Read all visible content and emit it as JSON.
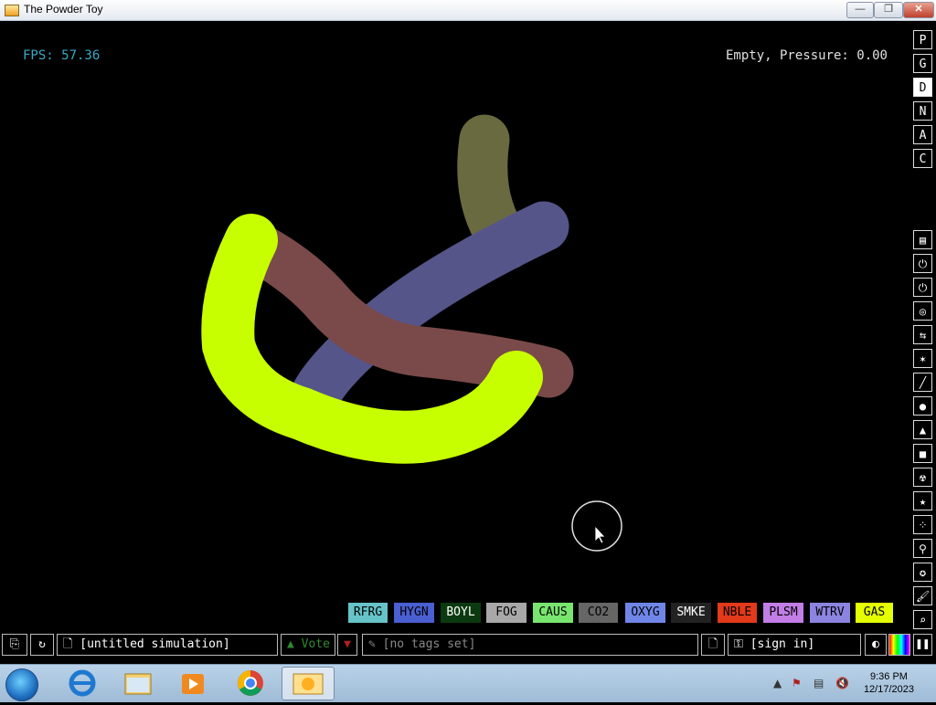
{
  "window": {
    "title": "The Powder Toy",
    "min": "—",
    "max": "❐",
    "close": "✕"
  },
  "hud": {
    "fps": "FPS: 57.36",
    "status": "Empty, Pressure: 0.00"
  },
  "menu_letters": [
    {
      "label": "P",
      "selected": false
    },
    {
      "label": "G",
      "selected": false
    },
    {
      "label": "D",
      "selected": true
    },
    {
      "label": "N",
      "selected": false
    },
    {
      "label": "A",
      "selected": false
    },
    {
      "label": "C",
      "selected": false
    }
  ],
  "tool_icons": [
    "walls-icon",
    "electronics-icon",
    "power-icon",
    "sensors-icon",
    "force-icon",
    "explosives-icon",
    "gases-icon",
    "liquids-icon",
    "powders-icon",
    "solids-icon",
    "radioactive-icon",
    "special-icon",
    "life-icon",
    "tools-icon",
    "favorites-icon",
    "decoration-icon",
    "search-icon"
  ],
  "elements": [
    {
      "label": "RFRG",
      "bg": "#66c3c8",
      "fg": "#000000"
    },
    {
      "label": "HYGN",
      "bg": "#4a5fd2",
      "fg": "#000000"
    },
    {
      "label": "BOYL",
      "bg": "#0c3a10",
      "fg": "#ffffff"
    },
    {
      "label": "FOG",
      "bg": "#a8a8a8",
      "fg": "#000000"
    },
    {
      "label": "CAUS",
      "bg": "#78e66e",
      "fg": "#000000"
    },
    {
      "label": "CO2",
      "bg": "#666666",
      "fg": "#000000"
    },
    {
      "label": "OXYG",
      "bg": "#6f86e8",
      "fg": "#000000"
    },
    {
      "label": "SMKE",
      "bg": "#222222",
      "fg": "#ffffff"
    },
    {
      "label": "NBLE",
      "bg": "#e23a1a",
      "fg": "#000000"
    },
    {
      "label": "PLSM",
      "bg": "#c27ee6",
      "fg": "#000000"
    },
    {
      "label": "WTRV",
      "bg": "#8c84e0",
      "fg": "#000000"
    },
    {
      "label": "GAS",
      "bg": "#e4ff00",
      "fg": "#000000"
    }
  ],
  "bottom": {
    "sim_name": "[untitled simulation]",
    "vote": "Vote",
    "tags": "[no tags set]",
    "sign_in": "[sign in]"
  },
  "taskbar": {
    "time": "9:36 PM",
    "date": "12/17/2023",
    "apps": [
      "start-button",
      "internet-explorer-icon",
      "file-explorer-icon",
      "media-player-icon",
      "chrome-icon",
      "powder-toy-taskbar-icon"
    ]
  },
  "colors": {
    "gas": "#c8ff00",
    "hydrogen": "#55558a",
    "smoke": "#7a4a4a",
    "olive": "#6a6a40",
    "fps": "#3aa9c6"
  }
}
